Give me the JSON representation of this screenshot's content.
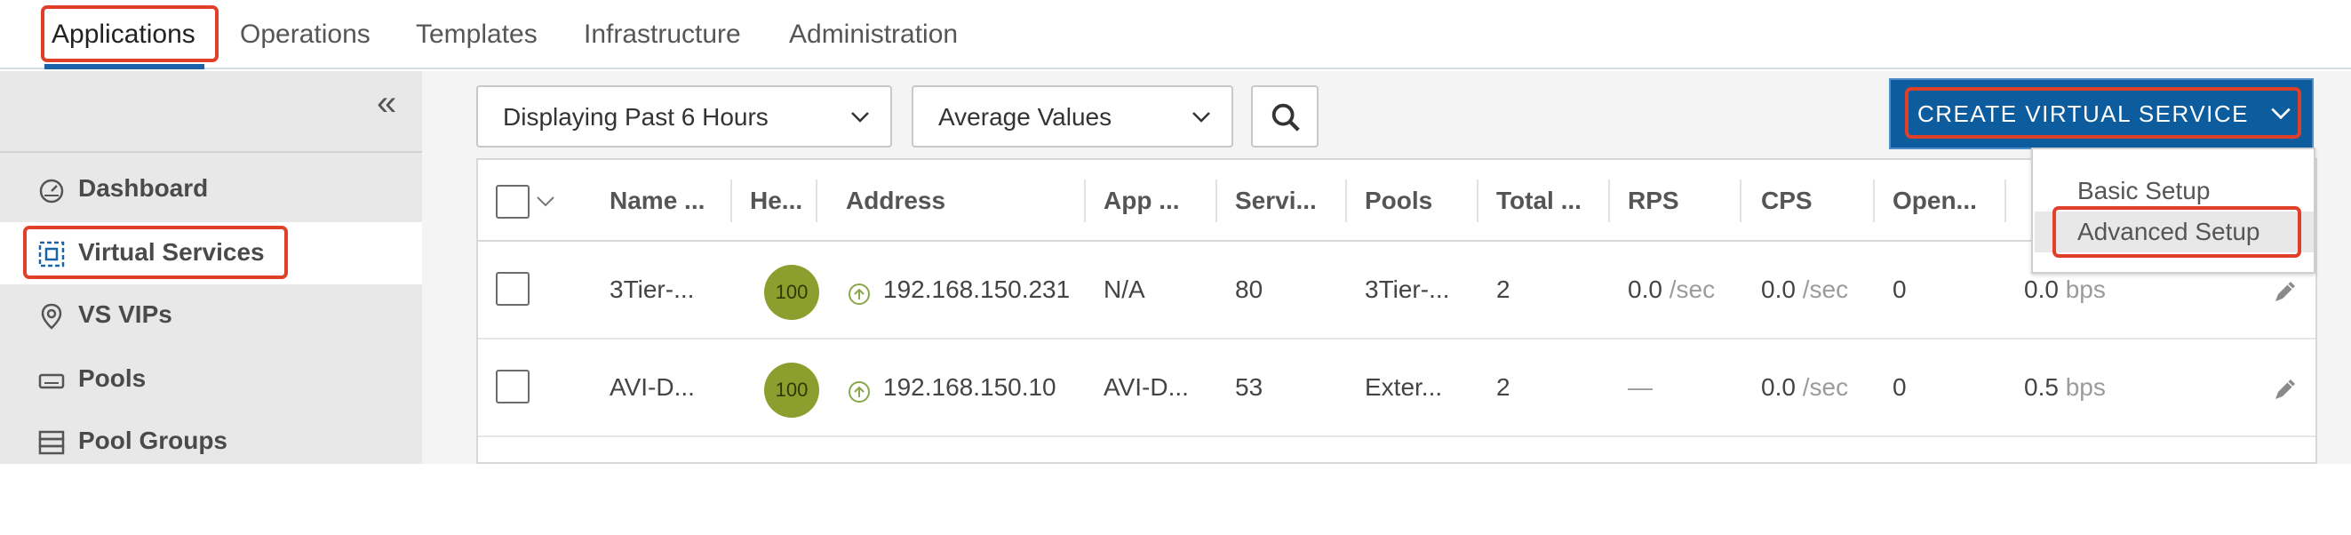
{
  "topnav": {
    "tabs": [
      {
        "label": "Applications"
      },
      {
        "label": "Operations"
      },
      {
        "label": "Templates"
      },
      {
        "label": "Infrastructure"
      },
      {
        "label": "Administration"
      }
    ],
    "active_tab": "Applications"
  },
  "sidebar": {
    "collapse_icon": "double-chevron-left-icon",
    "items": [
      {
        "label": "Dashboard",
        "icon": "speedometer-icon"
      },
      {
        "label": "Virtual Services",
        "icon": "virtual-service-icon",
        "active": true
      },
      {
        "label": "VS VIPs",
        "icon": "location-pin-icon"
      },
      {
        "label": "Pools",
        "icon": "server-drive-icon"
      },
      {
        "label": "Pool Groups",
        "icon": "stacked-servers-icon"
      }
    ]
  },
  "toolbar": {
    "time_range": "Displaying Past 6 Hours",
    "value_mode": "Average Values",
    "search_icon": "search-icon"
  },
  "create_button": {
    "label": "CREATE VIRTUAL SERVICE",
    "menu": [
      {
        "label": "Basic Setup"
      },
      {
        "label": "Advanced Setup"
      }
    ]
  },
  "table": {
    "columns": [
      "Name ...",
      "He...",
      "Address",
      "App ...",
      "Servi...",
      "Pools",
      "Total ...",
      "RPS",
      "CPS",
      "Open..."
    ],
    "rows": [
      {
        "name": "3Tier-...",
        "health": "100",
        "address": "192.168.150.231",
        "app": "N/A",
        "service": "80",
        "pools": "3Tier-...",
        "total": "2",
        "rps": "0.0",
        "rps_unit": "/sec",
        "cps": "0.0",
        "cps_unit": "/sec",
        "open": "0",
        "throughput": "0.0",
        "throughput_unit": "bps"
      },
      {
        "name": "AVI-D...",
        "health": "100",
        "address": "192.168.150.10",
        "app": "AVI-D...",
        "service": "53",
        "pools": "Exter...",
        "total": "2",
        "rps": "—",
        "rps_unit": "",
        "cps": "0.0",
        "cps_unit": "/sec",
        "open": "0",
        "throughput": "0.5",
        "throughput_unit": "bps"
      }
    ]
  },
  "colors": {
    "accent_blue": "#0d5c9e",
    "highlight_red": "#e0402a",
    "health_green": "#8c9e2d",
    "status_up_green": "#8aa64a"
  }
}
